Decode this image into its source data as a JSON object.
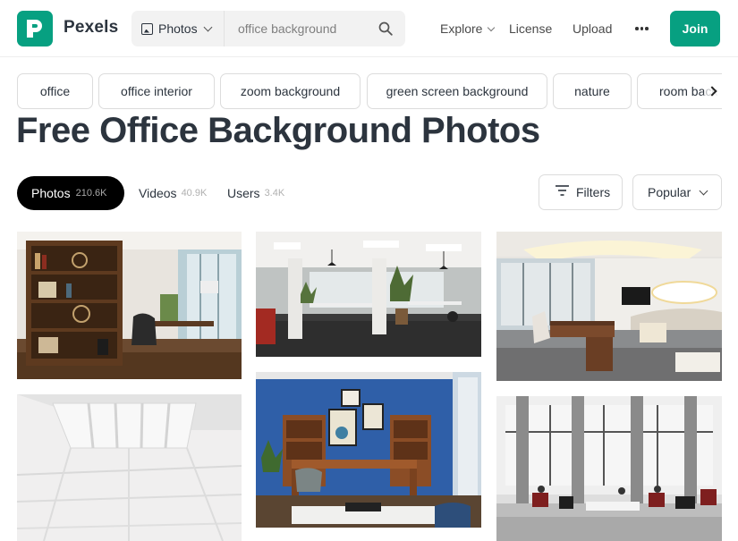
{
  "header": {
    "brand": "Pexels",
    "search_type": "Photos",
    "search_value": "office background",
    "nav": {
      "explore": "Explore",
      "license": "License",
      "upload": "Upload"
    },
    "join": "Join"
  },
  "tags": [
    "office",
    "office interior",
    "zoom background",
    "green screen background",
    "nature",
    "room back"
  ],
  "title": "Free Office Background Photos",
  "tabs": {
    "photos": {
      "label": "Photos",
      "count": "210.6K"
    },
    "videos": {
      "label": "Videos",
      "count": "40.9K"
    },
    "users": {
      "label": "Users",
      "count": "3.4K"
    }
  },
  "controls": {
    "filters": "Filters",
    "sort": "Popular"
  },
  "colors": {
    "brand": "#07a081",
    "text": "#2c343e"
  },
  "icons": [
    "pexels-logo-icon",
    "image-icon",
    "search-icon",
    "chevron-down-icon",
    "more-icon",
    "chevron-right-icon",
    "filter-icon"
  ]
}
